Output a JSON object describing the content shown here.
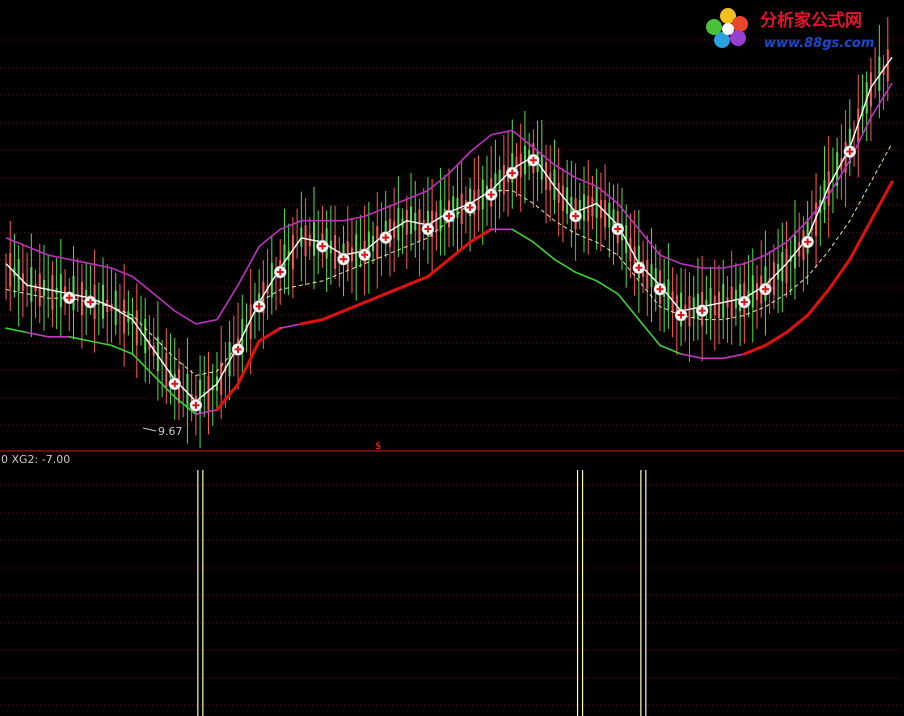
{
  "watermark": {
    "name": "分析家公式网",
    "url": "www.88gs.com"
  },
  "main_panel": {
    "low_annotation": "9.67",
    "marker_glyph": "$"
  },
  "sub_panel": {
    "indicator_label": "0  XG2: -7.00"
  },
  "colors": {
    "background": "#000000",
    "grid": "#7a1a1a",
    "separator": "#b01515",
    "up_candle": "#ff5a5a",
    "down_candle": "#4fe04f",
    "price_line": "#ffffff",
    "upper_band": "#c030c0",
    "lower_band_down": "#3ad43a",
    "lower_band_up": "#e01010",
    "lower_band_flat": "#c838c8",
    "mid_dashed": "#e8e8a0",
    "signal_bar": "#ffffa8"
  },
  "chart_data": [
    {
      "type": "line",
      "title": "",
      "series": [
        {
          "values": [
            11.45,
            11.2,
            11.15,
            11.1,
            11.05,
            10.95,
            10.8,
            10.45,
            10.1,
            9.85,
            10.05,
            10.5,
            11.0,
            11.4,
            11.75,
            11.7,
            11.55,
            11.6,
            11.8,
            11.95,
            11.9,
            12.05,
            12.15,
            12.3,
            12.55,
            12.7,
            12.35,
            12.05,
            12.15,
            11.9,
            11.45,
            11.2,
            10.9,
            10.95,
            11.0,
            11.05,
            11.2,
            11.45,
            11.75,
            12.35,
            12.8,
            13.5,
            13.85
          ]
        },
        {
          "values": [
            11.75,
            11.65,
            11.55,
            11.5,
            11.45,
            11.4,
            11.3,
            11.1,
            10.9,
            10.75,
            10.8,
            11.2,
            11.65,
            11.85,
            11.95,
            11.95,
            11.95,
            12.0,
            12.1,
            12.2,
            12.3,
            12.5,
            12.75,
            12.95,
            13.0,
            12.8,
            12.6,
            12.45,
            12.35,
            12.15,
            11.85,
            11.55,
            11.45,
            11.4,
            11.4,
            11.45,
            11.55,
            11.7,
            11.95,
            12.25,
            12.65,
            13.15,
            13.55
          ]
        },
        {
          "values": [
            11.15,
            11.1,
            11.05,
            11.05,
            11.0,
            10.95,
            10.85,
            10.6,
            10.35,
            10.15,
            10.2,
            10.5,
            11.0,
            11.15,
            11.2,
            11.25,
            11.35,
            11.45,
            11.55,
            11.65,
            11.75,
            11.95,
            12.15,
            12.3,
            12.3,
            12.15,
            11.95,
            11.8,
            11.7,
            11.55,
            11.25,
            10.95,
            10.85,
            10.8,
            10.8,
            10.85,
            10.95,
            11.1,
            11.3,
            11.6,
            11.95,
            12.4,
            12.85
          ]
        }
      ],
      "signal_markers": [
        3,
        4,
        8,
        9,
        11,
        12,
        13,
        15,
        16,
        17,
        18,
        20,
        21,
        22,
        23,
        24,
        25,
        27,
        29,
        30,
        31,
        32,
        33,
        35,
        36,
        38,
        40
      ]
    },
    {
      "type": "bar",
      "title": "",
      "series": [
        {
          "name": "XG2",
          "values": [
            0,
            0,
            0,
            0,
            0,
            0,
            0,
            0,
            0,
            1,
            0,
            0,
            0,
            0,
            0,
            0,
            0,
            0,
            0,
            0,
            0,
            0,
            0,
            0,
            0,
            0,
            0,
            1,
            0,
            0,
            1,
            0,
            0,
            0,
            0,
            0,
            0,
            0,
            0,
            0,
            0,
            0,
            0
          ]
        }
      ]
    }
  ]
}
